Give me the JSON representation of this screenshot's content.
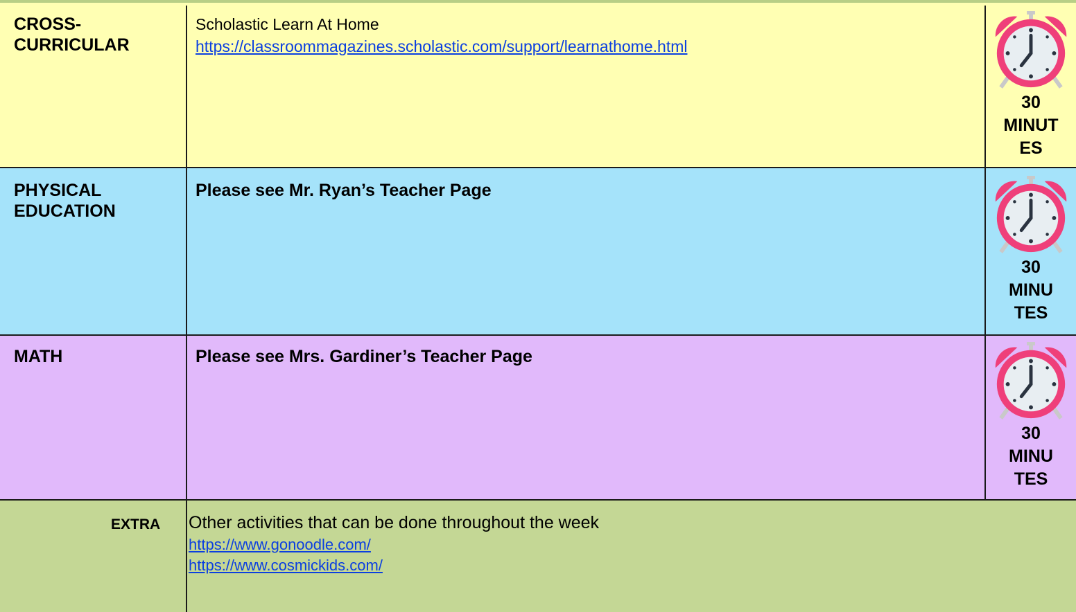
{
  "rows": {
    "cross": {
      "subject": "CROSS-\nCURRICULAR",
      "title": "Scholastic Learn At Home",
      "link": "https://classroommagazines.scholastic.com/support/learnathome.html",
      "timer": "30\nMINUT\nES"
    },
    "pe": {
      "subject": "PHYSICAL\nEDUCATION",
      "text": "Please see Mr. Ryan’s Teacher Page",
      "timer": "30\nMINU\nTES"
    },
    "math": {
      "subject": "MATH",
      "text": "Please see Mrs. Gardiner’s Teacher Page",
      "timer": "30\nMINU\nTES"
    },
    "extra": {
      "subject": "EXTRA",
      "title": "Other activities that can be done throughout the week",
      "links": [
        "https://www.gonoodle.com/",
        "https://www.cosmickids.com/"
      ]
    }
  },
  "colors": {
    "cross_bg": "#ffffb3",
    "pe_bg": "#a5e3fa",
    "math_bg": "#e1b9fb",
    "extra_bg": "#c4d795",
    "link": "#0b3fe0",
    "clock_accent": "#ef3f7a"
  },
  "icons": {
    "timer": "alarm-clock-icon"
  }
}
